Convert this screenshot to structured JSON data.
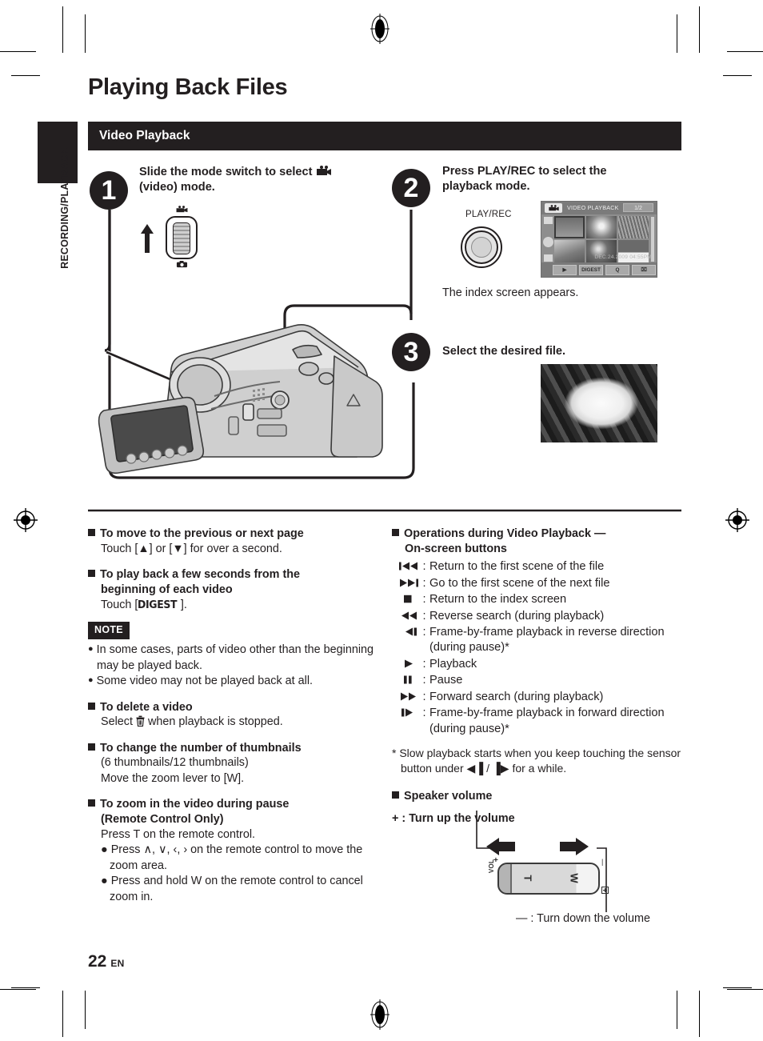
{
  "document": {
    "title": "Playing Back Files",
    "section": "Video Playback",
    "side_tab_label": "RECORDING/PLAYBACK",
    "page_number": "22",
    "page_lang": "EN"
  },
  "steps": [
    {
      "number": "1",
      "text": "Slide the mode switch to select ☀ (video) mode.",
      "line1": "Slide the mode switch to select",
      "line2": "(video) mode.",
      "icon": "video-camera-icon"
    },
    {
      "number": "2",
      "text": "Press PLAY/REC to select the playback mode.",
      "line1": "Press PLAY/REC to select the",
      "line2": "playback mode.",
      "caption": "The index screen appears.",
      "button_label": "PLAY/REC"
    },
    {
      "number": "3",
      "text": "Select the desired file.",
      "line1": "Select the desired file.",
      "line2": ""
    }
  ],
  "lcd": {
    "title": "VIDEO PLAYBACK",
    "page_indicator": "1/2",
    "date": "DEC.24.2009 04:55PM",
    "buttons": [
      "▶",
      "DIGEST",
      "⌕",
      "Ὕ1"
    ],
    "button_labels": {
      "play": "▶",
      "digest": "DIGEST",
      "search": "Q",
      "delete": "⌧"
    }
  },
  "left_column": {
    "blocks": [
      {
        "heading": "To move to the previous or next page",
        "body": "Touch [▲] or [▼] for over a second."
      },
      {
        "heading_line1": "To play back a few seconds from the",
        "heading_line2": "beginning of each video",
        "body_prefix": "Touch [",
        "body_token": "DIGEST",
        "body_suffix": "]."
      }
    ],
    "note": {
      "label": "NOTE",
      "items": [
        "In some cases, parts of video other than the beginning may be played back.",
        "Some video may not be played back at all."
      ]
    },
    "delete_block": {
      "heading": "To delete a video",
      "body_prefix": "Select",
      "body_icon": "trash-icon",
      "body_suffix": "when playback is stopped."
    },
    "thumbnails_block": {
      "heading": "To change the number of thumbnails",
      "body_line1": "(6 thumbnails/12 thumbnails)",
      "body_line2": "Move the zoom lever to [W]."
    },
    "zoom_block": {
      "heading_line1": "To zoom in the video during pause",
      "heading_line2": "(Remote Control Only)",
      "body_line1": "Press T on the remote control.",
      "bullets": [
        "Press ∧, ∨, ‹, › on the remote control to move the zoom area.",
        "Press and hold W on the remote control to cancel zoom in."
      ]
    }
  },
  "right_column": {
    "ops_heading_line1": "Operations during Video Playback —",
    "ops_heading_line2": "On-screen buttons",
    "operations": [
      {
        "icon": "skip-back-icon",
        "glyph": "⏮",
        "text": "Return to the first scene of the file"
      },
      {
        "icon": "skip-forward-icon",
        "glyph": "⏭",
        "text": "Go to the first scene of the next file"
      },
      {
        "icon": "stop-icon",
        "glyph": "■",
        "text": "Return to the index screen"
      },
      {
        "icon": "rewind-icon",
        "glyph": "◀◀",
        "text": "Reverse search (during playback)"
      },
      {
        "icon": "frame-back-icon",
        "glyph": "◀▐",
        "text": "Frame-by-frame playback in reverse direction (during pause)*"
      },
      {
        "icon": "play-icon",
        "glyph": "▶",
        "text": "Playback"
      },
      {
        "icon": "pause-icon",
        "glyph": "▐▐",
        "text": "Pause"
      },
      {
        "icon": "fast-forward-icon",
        "glyph": "▶▶",
        "text": "Forward search (during playback)"
      },
      {
        "icon": "frame-forward-icon",
        "glyph": "▐▶",
        "text": "Frame-by-frame playback in forward direction (during pause)*"
      }
    ],
    "footnote": "* Slow playback starts when you keep touching the sensor button under ◀▐ / ▐▶ for a while.",
    "speaker_heading": "Speaker volume",
    "volume_up": "+ : Turn up the volume",
    "volume_down": "— : Turn down the volume",
    "lever": {
      "vol": "VOL",
      "plus": "+",
      "t": "T",
      "w": "W"
    }
  },
  "colors": {
    "ink": "#231f20",
    "paper": "#ffffff"
  }
}
